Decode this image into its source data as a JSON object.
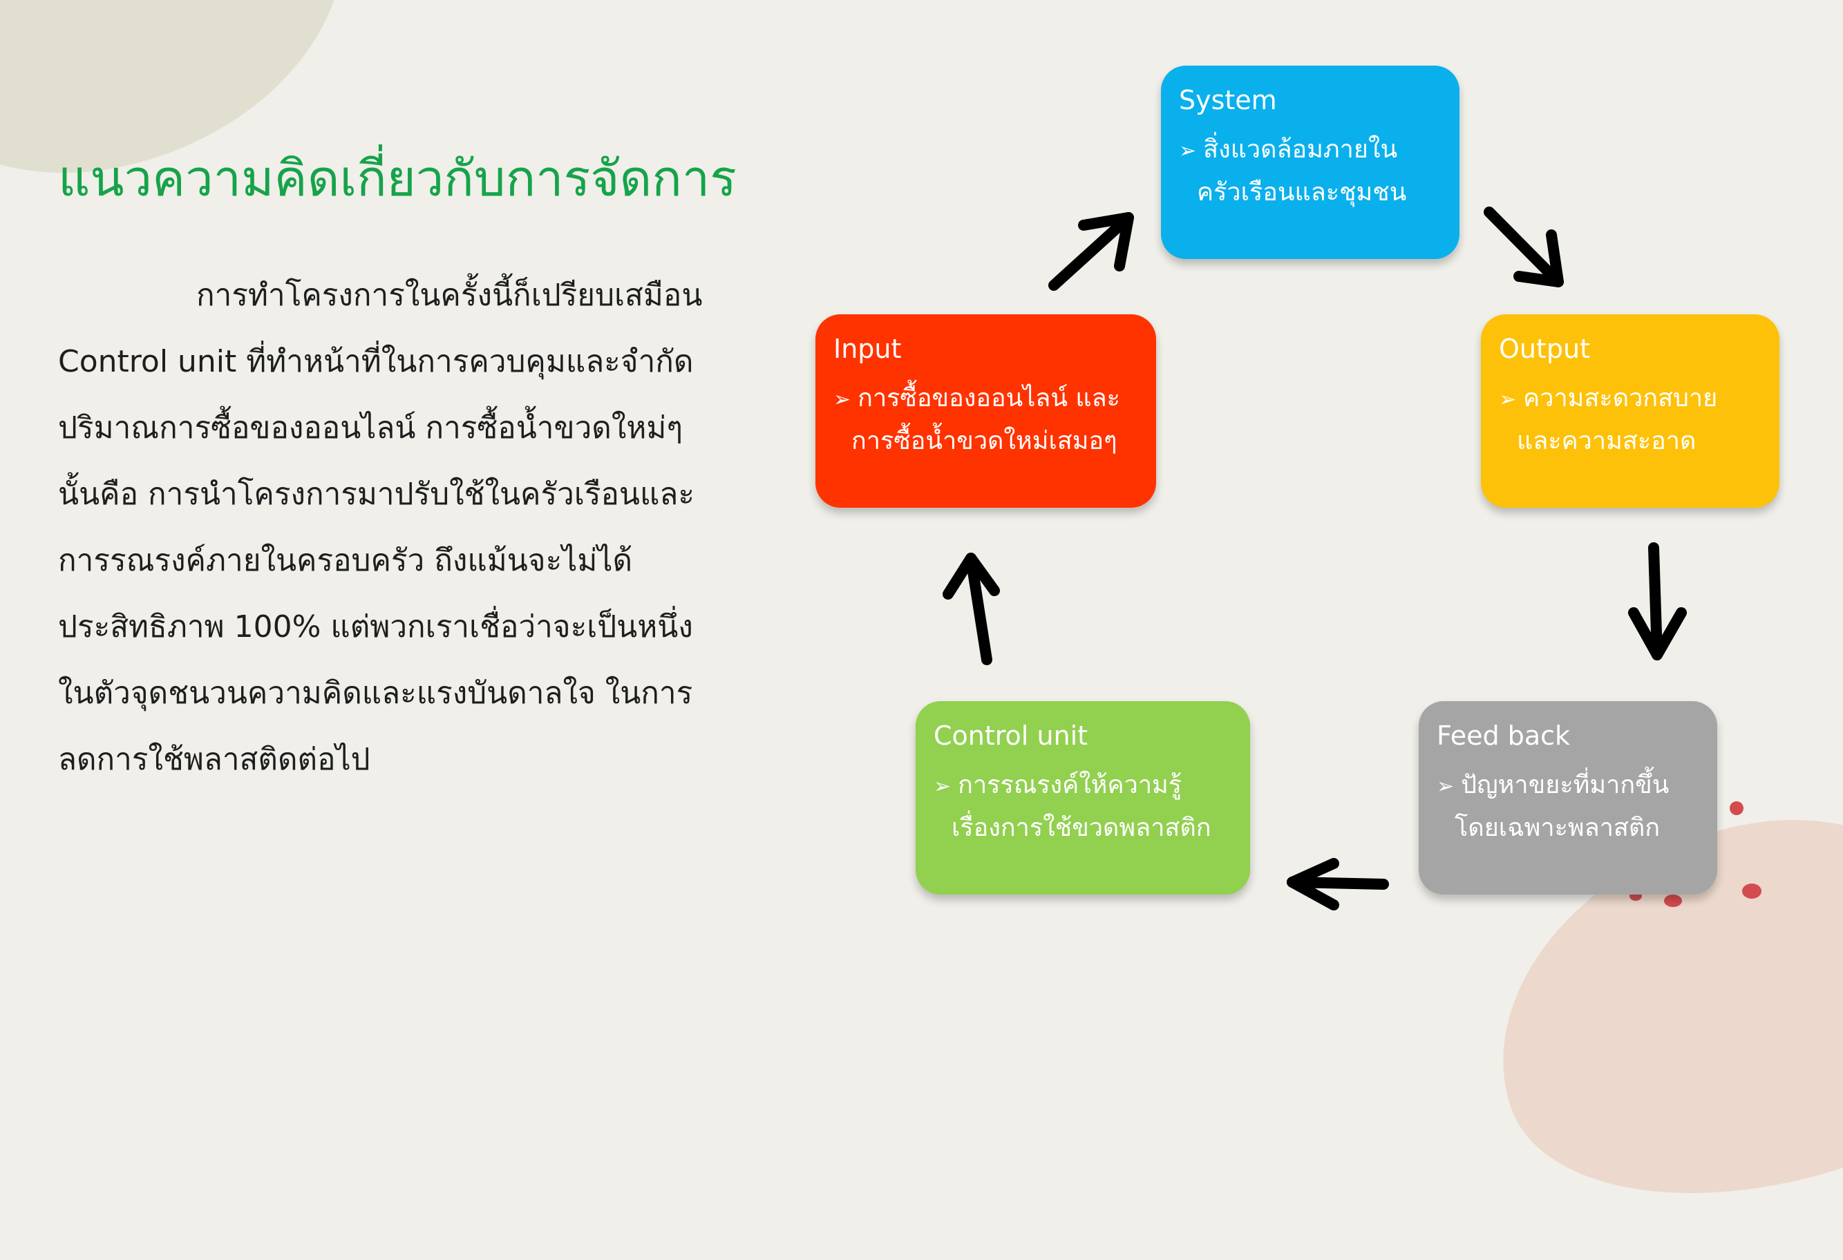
{
  "heading": "แนวความคิดเกี่ยวกับการจัดการ",
  "body_lines": [
    "การทำโครงการในครั้งนี้ก็เปรียบเสมือน",
    "Control unit ที่ทำหน้าที่ในการควบคุมและจำกัด",
    "ปริมาณการซื้อของออนไลน์ การซื้อน้ำขวดใหม่ๆ",
    "นั้นคือ การนำโครงการมาปรับใช้ในครัวเรือนและ",
    "การรณรงค์ภายในครอบครัว ถึงแม้นจะไม่ได้",
    "ประสิทธิภาพ 100% แต่พวกเราเชื่อว่าจะเป็นหนึ่ง",
    "ในตัวจุดชนวนความคิดและแรงบันดาลใจ ในการ",
    "ลดการใช้พลาสติดต่อไป"
  ],
  "bullet_symbol": "➢",
  "boxes": {
    "system": {
      "title": "System",
      "line1": "สิ่งแวดล้อมภายใน",
      "line2": "ครัวเรือนและชุมชน",
      "color": "#0ab0ec"
    },
    "output": {
      "title": "Output",
      "line1": "ความสะดวกสบาย",
      "line2": "และความสะอาด",
      "color": "#fec10a"
    },
    "feedback": {
      "title": "Feed back",
      "line1": "ปัญหาขยะที่มากขึ้น",
      "line2": "โดยเฉพาะพลาสติก",
      "color": "#a5a5a5"
    },
    "control": {
      "title": "Control unit",
      "line1": "การรณรงค์ให้ความรู้",
      "line2": "เรื่องการใช้ขวดพลาสติก",
      "color": "#92d050"
    },
    "input": {
      "title": "Input",
      "line1": "การซื้อของออนไลน์ และ",
      "line2": "การซื้อน้ำขวดใหม่เสมอๆ",
      "color": "#ff3300"
    }
  },
  "colors": {
    "heading": "#16a34a",
    "background": "#f0efe9",
    "arrow": "#000000"
  }
}
